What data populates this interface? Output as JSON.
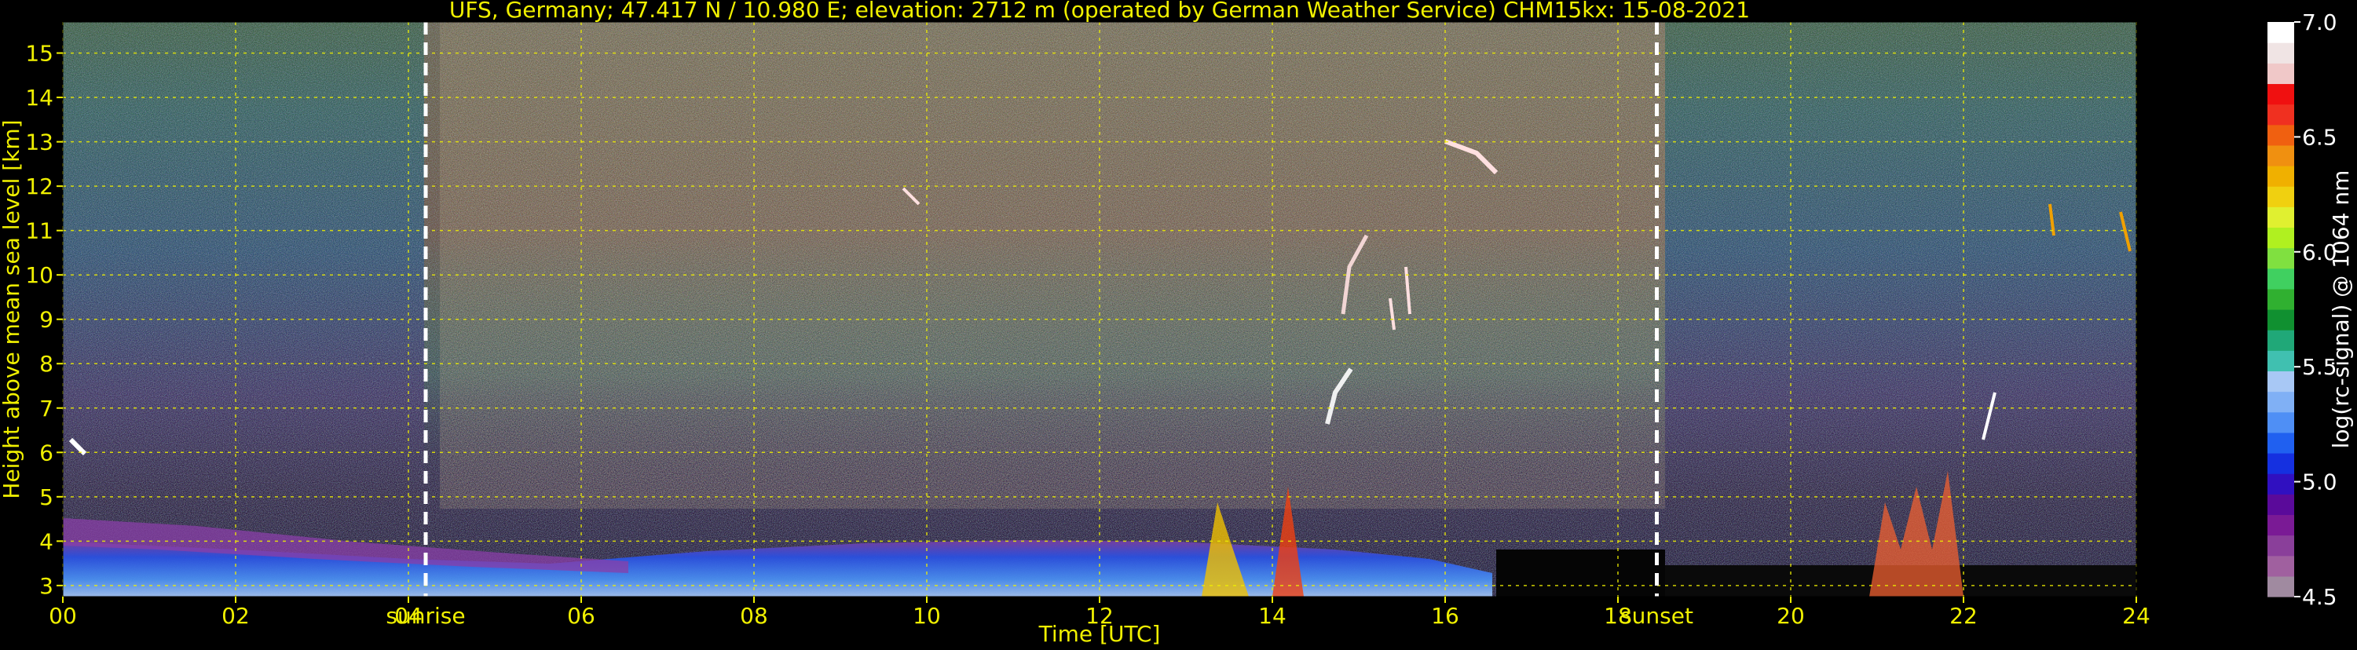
{
  "chart_data": {
    "type": "heatmap",
    "title": "UFS, Germany; 47.417 N / 10.980 E; elevation: 2712 m  (operated by German Weather Service)    CHM15kx: 15-08-2021",
    "xlabel": "Time [UTC]",
    "ylabel": "Height above mean sea level [km]",
    "colorbar_label": "log(rc-signal) @ 1064 nm",
    "x_ticks": [
      "00",
      "02",
      "04",
      "06",
      "08",
      "10",
      "12",
      "14",
      "16",
      "18",
      "20",
      "22",
      "24"
    ],
    "x_tick_values": [
      0,
      2,
      4,
      6,
      8,
      10,
      12,
      14,
      16,
      18,
      20,
      22,
      24
    ],
    "y_ticks": [
      "3",
      "4",
      "5",
      "6",
      "7",
      "8",
      "9",
      "10",
      "11",
      "12",
      "13",
      "14",
      "15"
    ],
    "y_tick_values": [
      3,
      4,
      5,
      6,
      7,
      8,
      9,
      10,
      11,
      12,
      13,
      14,
      15
    ],
    "xlim": [
      0,
      24
    ],
    "ylim": [
      2.75,
      15.7
    ],
    "grid": true,
    "colorbar": {
      "range": [
        4.5,
        7.0
      ],
      "ticks": [
        "4.5",
        "5.0",
        "5.5",
        "6.0",
        "6.5",
        "7.0"
      ],
      "tick_values": [
        4.5,
        5.0,
        5.5,
        6.0,
        6.5,
        7.0
      ],
      "colors": [
        "#a08aa0",
        "#a0609f",
        "#8a3f9a",
        "#7a1a95",
        "#5a0a9a",
        "#3010c0",
        "#1530e0",
        "#2060f0",
        "#4f8ff5",
        "#80b0f5",
        "#a8c8f5",
        "#40c0b0",
        "#20a878",
        "#109030",
        "#30b030",
        "#40d060",
        "#80e040",
        "#b0f020",
        "#e0f030",
        "#f0d010",
        "#f0b000",
        "#f09010",
        "#f06010",
        "#f03020",
        "#f01010",
        "#f0c8c8",
        "#f0e4e4",
        "#ffffff"
      ]
    },
    "annotations": [
      {
        "label": "sunrise",
        "x": 4.2
      },
      {
        "label": "sunset",
        "x": 18.45
      }
    ]
  }
}
